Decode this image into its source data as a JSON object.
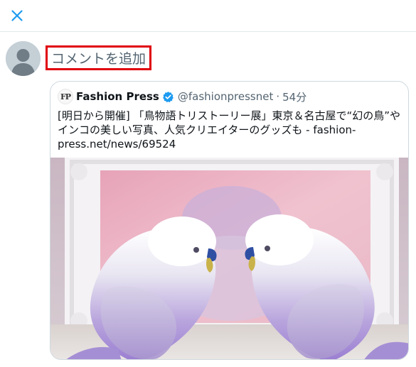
{
  "header": {
    "close_icon": "close-icon"
  },
  "composer": {
    "placeholder": "コメントを追加",
    "avatar_icon": "default-avatar-icon"
  },
  "quoted_tweet": {
    "logo_text": "FP",
    "display_name": "Fashion Press",
    "verified": true,
    "handle": "@fashionpressnet",
    "separator": "·",
    "time": "54分",
    "text": "[明日から開催] 「鳥物語トリストーリー展」東京＆名古屋で“幻の鳥”やインコの美しい写真、人気クリエイターのグッズも - fashion-press.net/news/69524",
    "image_alt": "two lavender budgerigars facing each other in front of a white frame"
  },
  "colors": {
    "accent": "#1d9bf0",
    "highlight_border": "#e0000b",
    "placeholder_text": "#536471",
    "divider": "#e1e8ed"
  }
}
